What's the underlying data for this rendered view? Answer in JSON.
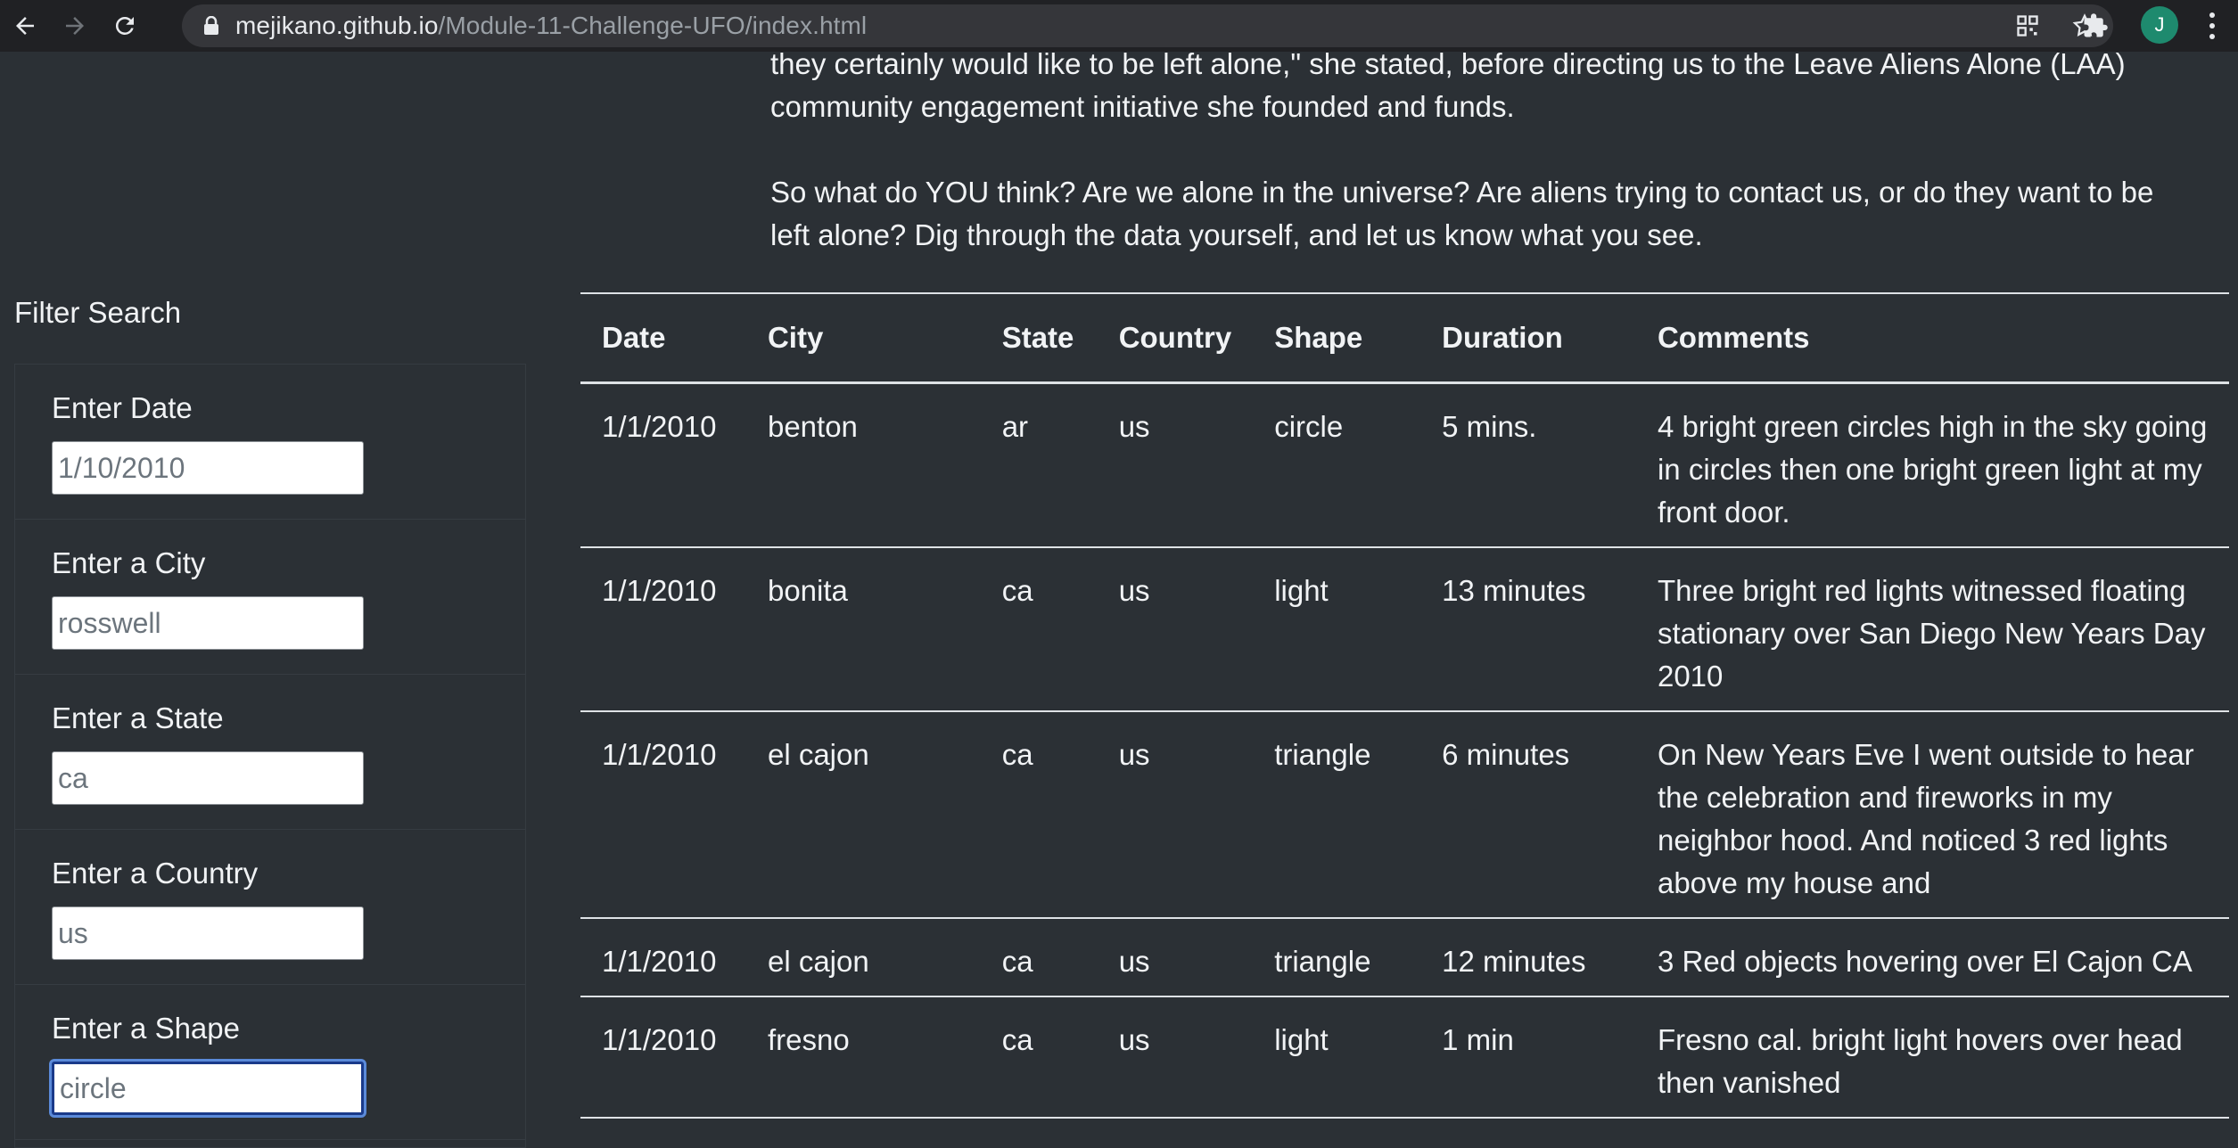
{
  "browser": {
    "url_host": "mejikano.github.io",
    "url_path": "/Module-11-Challenge-UFO/index.html",
    "avatar_initial": "J"
  },
  "intro": {
    "paragraph_1": "they certainly would like to be left alone,\" she stated, before directing us to the Leave Aliens Alone (LAA) community engagement initiative she founded and funds.",
    "paragraph_2": "So what do YOU think? Are we alone in the universe? Are aliens trying to contact us, or do they want to be left alone? Dig through the data yourself, and let us know what you see."
  },
  "filters": {
    "title": "Filter Search",
    "items": [
      {
        "label": "Enter Date",
        "value": "1/10/2010"
      },
      {
        "label": "Enter a City",
        "value": "rosswell"
      },
      {
        "label": "Enter a State",
        "value": "ca"
      },
      {
        "label": "Enter a Country",
        "value": "us"
      },
      {
        "label": "Enter a Shape",
        "value": "circle"
      }
    ]
  },
  "table": {
    "headers": [
      "Date",
      "City",
      "State",
      "Country",
      "Shape",
      "Duration",
      "Comments"
    ],
    "rows": [
      [
        "1/1/2010",
        "benton",
        "ar",
        "us",
        "circle",
        "5 mins.",
        "4 bright green circles high in the sky going in circles then one bright green light at my front door."
      ],
      [
        "1/1/2010",
        "bonita",
        "ca",
        "us",
        "light",
        "13 minutes",
        "Three bright red lights witnessed floating stationary over San Diego New Years Day 2010"
      ],
      [
        "1/1/2010",
        "el cajon",
        "ca",
        "us",
        "triangle",
        "6 minutes",
        "On New Years Eve I went outside to hear the celebration and fireworks in my neighbor hood. And noticed 3 red lights above my house and"
      ],
      [
        "1/1/2010",
        "el cajon",
        "ca",
        "us",
        "triangle",
        "12 minutes",
        "3 Red objects hovering over El Cajon CA"
      ],
      [
        "1/1/2010",
        "fresno",
        "ca",
        "us",
        "light",
        "1 min",
        "Fresno cal. bright light hovers over head then vanished"
      ]
    ]
  }
}
